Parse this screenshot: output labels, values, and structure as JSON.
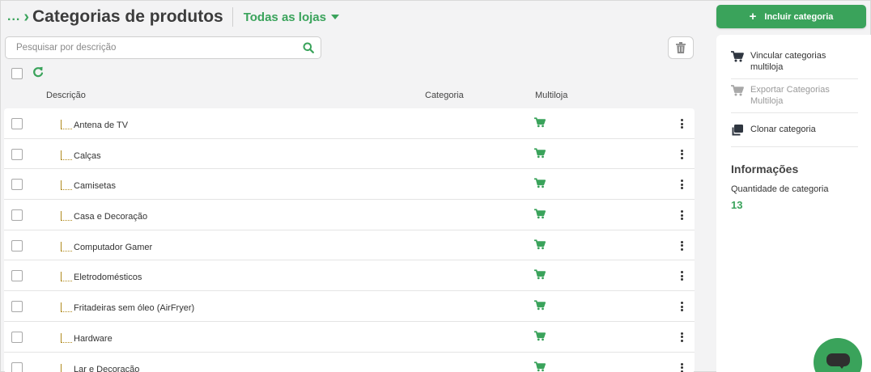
{
  "header": {
    "breadcrumb_ellipsis": "...",
    "title": "Categorias de produtos",
    "store_filter": "Todas as lojas"
  },
  "search": {
    "placeholder": "Pesquisar por descrição",
    "value": ""
  },
  "table": {
    "columns": [
      "Descrição",
      "Categoria",
      "Multiloja"
    ],
    "rows": [
      {
        "description": "Antena de TV",
        "category": "",
        "multiloja": true
      },
      {
        "description": "Calças",
        "category": "",
        "multiloja": true
      },
      {
        "description": "Camisetas",
        "category": "",
        "multiloja": true
      },
      {
        "description": "Casa e Decoração",
        "category": "",
        "multiloja": true
      },
      {
        "description": "Computador Gamer",
        "category": "",
        "multiloja": true
      },
      {
        "description": "Eletrodomésticos",
        "category": "",
        "multiloja": true
      },
      {
        "description": "Fritadeiras sem óleo (AirFryer)",
        "category": "",
        "multiloja": true
      },
      {
        "description": "Hardware",
        "category": "",
        "multiloja": true
      },
      {
        "description": "Lar e Decoração",
        "category": "",
        "multiloja": true
      }
    ]
  },
  "sidebar": {
    "add_button_label": "Incluir categoria",
    "actions": [
      {
        "label": "Vincular categorias multiloja",
        "enabled": true,
        "icon": "cart-icon"
      },
      {
        "label": "Exportar Categorias Multiloja",
        "enabled": false,
        "icon": "cart-icon"
      },
      {
        "label": "Clonar categoria",
        "enabled": true,
        "icon": "clone-icon"
      }
    ],
    "info": {
      "title": "Informações",
      "quantity_label": "Quantidade de categoria",
      "quantity_value": "13"
    }
  },
  "colors": {
    "accent": "#3aa35b",
    "background": "#f3f3f4",
    "panel": "#ffffff"
  }
}
